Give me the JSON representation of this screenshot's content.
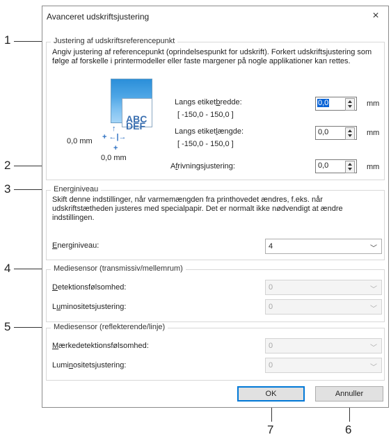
{
  "callouts": [
    "1",
    "2",
    "3",
    "4",
    "5",
    "6",
    "7"
  ],
  "dialog": {
    "title": "Avanceret udskriftsjustering",
    "close": "×"
  },
  "ref_point": {
    "title": "Justering af udskriftsreferencepunkt",
    "description": "Angiv justering af referencepunkt (oprindelsespunkt for udskrift). Forkert udskriftsjustering som følge af forskelle i printermodeller eller faste margener på nogle applikationer kan rettes.",
    "illus_text": [
      "ABC",
      "DEF"
    ],
    "mm_left": "0,0 mm",
    "mm_bottom": "0,0 mm",
    "width_label_pre": "Langs etiket",
    "width_label_u": "b",
    "width_label_post": "redde:",
    "width_range": "[ -150,0 - 150,0 ]",
    "width_value": "0,0",
    "length_label_pre": "Langs etiket",
    "length_label_u": "l",
    "length_label_post": "ængde:",
    "length_range": "[ -150,0 - 150,0 ]",
    "length_value": "0,0",
    "tear_label_pre": "A",
    "tear_label_u": "f",
    "tear_label_post": "rivningsjustering:",
    "tear_value": "0,0",
    "unit": "mm"
  },
  "energy": {
    "title": "Energiniveau",
    "description": "Skift denne indstillinger, når varmemængden fra printhovedet ændres, f.eks. når udskriftstætheden justeres med specialpapir. Det er normalt ikke nødvendigt at ændre indstillingen.",
    "label_u": "E",
    "label_post": "nerginiveau:",
    "value": "4"
  },
  "sensor_trans": {
    "title": "Mediesensor (transmissiv/mellemrum)",
    "det_u": "D",
    "det_post": "etektionsfølsomhed:",
    "det_value": "0",
    "lum_pre": "L",
    "lum_u": "u",
    "lum_post": "minositetsjustering:",
    "lum_value": "0"
  },
  "sensor_refl": {
    "title": "Mediesensor (reflekterende/linje)",
    "mark_u": "M",
    "mark_post": "ærkedetektionsfølsomhed:",
    "mark_value": "0",
    "lum_pre": "Lumi",
    "lum_u": "n",
    "lum_post": "ositetsjustering:",
    "lum_value": "0"
  },
  "buttons": {
    "ok": "OK",
    "cancel": "Annuller"
  }
}
